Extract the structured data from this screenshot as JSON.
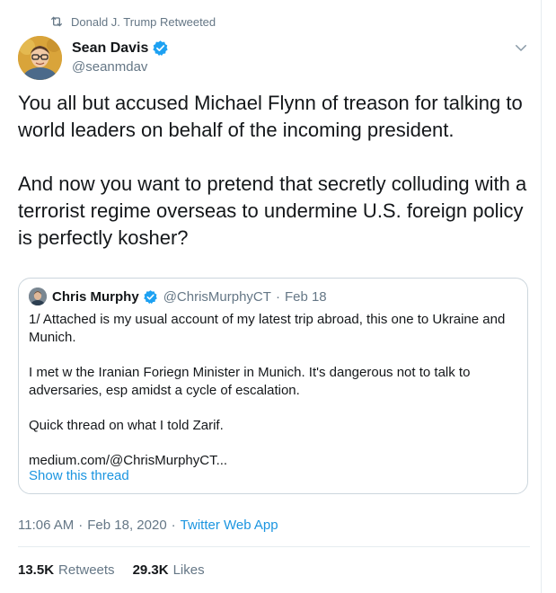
{
  "retweet_banner": {
    "text": "Donald J. Trump Retweeted",
    "icon": "retweet-icon"
  },
  "author": {
    "name": "Sean Davis",
    "handle": "@seanmdav",
    "verified": true
  },
  "tweet": {
    "paragraphs": [
      "You all but accused Michael Flynn of treason for talking to world leaders on behalf of the incoming president.",
      "And now you want to pretend that secretly colluding with a terrorist regime overseas to undermine U.S. foreign policy is perfectly kosher?"
    ]
  },
  "quoted_tweet": {
    "name": "Chris Murphy",
    "handle": "@ChrisMurphyCT",
    "separator": "·",
    "date": "Feb 18",
    "lines": [
      "1/ Attached is my usual account of my latest trip abroad, this one to Ukraine and Munich.",
      "I met w the Iranian Foriegn Minister in Munich. It's dangerous not to talk to adversaries, esp amidst a cycle of escalation.",
      "Quick thread on what I told Zarif.",
      "medium.com/@ChrisMurphyCT..."
    ],
    "show_thread": "Show this thread"
  },
  "meta": {
    "time": "11:06 AM",
    "separator": "·",
    "date": "Feb 18, 2020",
    "source": "Twitter Web App"
  },
  "stats": {
    "retweets_count": "13.5K",
    "retweets_label": "Retweets",
    "likes_count": "29.3K",
    "likes_label": "Likes"
  },
  "colors": {
    "link": "#1b95e0",
    "muted": "#657786",
    "verified": "#1da1f2",
    "border": "#ccd6dd"
  }
}
